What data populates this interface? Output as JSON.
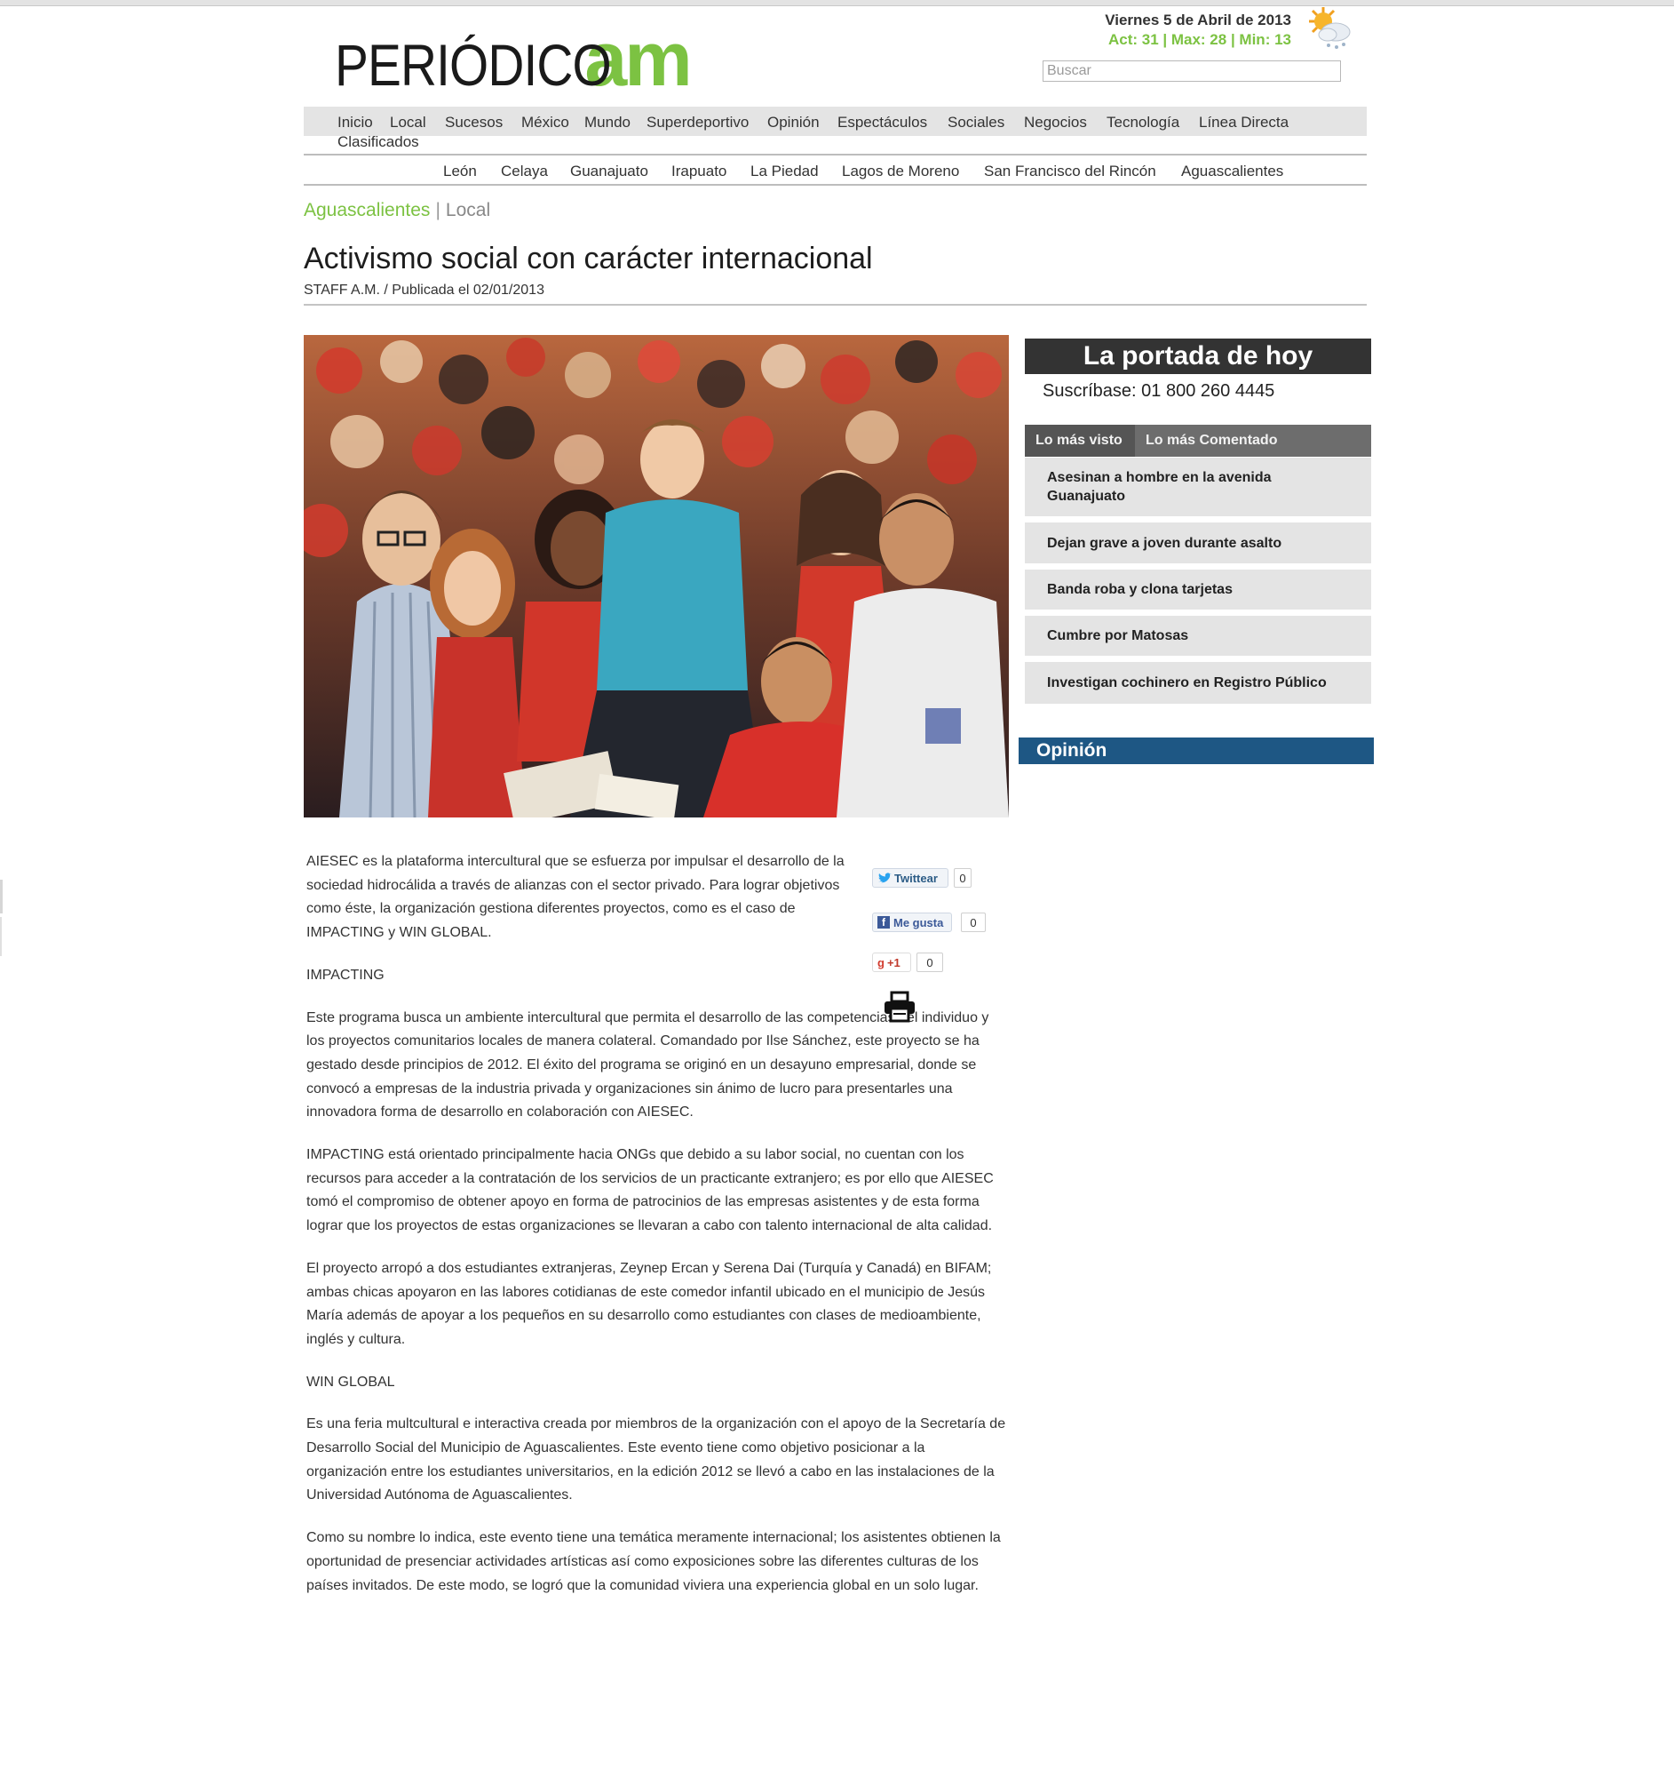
{
  "header": {
    "logo_text": "PERIÓDICO",
    "logo_accent": "am",
    "date": "Viernes 5 de Abril de 2013",
    "weather": "Act: 31 | Max: 28 | Min: 13",
    "weather_icon": "sun-cloud-icon",
    "search_placeholder": "Buscar"
  },
  "nav": {
    "items": [
      "Inicio",
      "Local",
      "Sucesos",
      "México",
      "Mundo",
      "Superdeportivo",
      "Opinión",
      "Espectáculos",
      "Sociales",
      "Negocios",
      "Tecnología",
      "Línea Directa",
      "Clasificados"
    ],
    "cities": [
      "León",
      "Celaya",
      "Guanajuato",
      "Irapuato",
      "La Piedad",
      "Lagos de Moreno",
      "San Francisco del Rincón",
      "Aguascalientes"
    ]
  },
  "breadcrumb": {
    "section": "Aguascalientes",
    "separator": "|",
    "category": "Local"
  },
  "article": {
    "title": "Activismo social con carácter internacional",
    "byline": "STAFF A.M. / Publicada el 02/01/2013",
    "paragraphs": [
      "AIESEC  es la plataforma intercultural que se esfuerza por impulsar el desarrollo de la sociedad hidrocálida a través de alianzas con el sector privado. Para lograr objetivos como éste, la organización gestiona diferentes proyectos, como es el caso de IMPACTING y WIN GLOBAL.",
      "IMPACTING",
      "Este programa busca un ambiente intercultural que permita el desarrollo de las competencias del individuo y los proyectos comunitarios locales de manera colateral. Comandado por Ilse Sánchez, este proyecto se ha gestado desde principios de 2012. El éxito del programa se originó en un desayuno empresarial, donde se convocó a empresas de la industria privada y organizaciones sin ánimo de lucro para presentarles una innovadora forma de desarrollo en colaboración con AIESEC.",
      "IMPACTING está orientado principalmente hacia ONGs que debido a su labor social, no cuentan con los recursos para acceder a la contratación de los servicios de un practicante extranjero; es por ello que AIESEC tomó el compromiso de obtener apoyo en forma de patrocinios de las empresas asistentes y de esta forma lograr que los proyectos de estas organizaciones se llevaran a cabo con talento internacional de alta calidad.",
      "El proyecto arropó a dos estudiantes extranjeras, Zeynep Ercan y Serena Dai (Turquía y Canadá) en BIFAM; ambas chicas apoyaron en las labores cotidianas de este comedor infantil ubicado en el municipio de Jesús María además de apoyar a los pequeños en su desarrollo como estudiantes con clases de medioambiente, inglés y cultura.",
      "WIN GLOBAL",
      "Es una feria multcultural e interactiva creada por miembros de la organización con el apoyo de la Secretaría de Desarrollo Social del Municipio de Aguascalientes. Este evento tiene como objetivo posicionar a la organización entre los estudiantes universitarios, en la edición 2012 se llevó a cabo en las instalaciones de la Universidad Autónoma de Aguascalientes.",
      "Como su nombre lo indica, este evento tiene una temática meramente internacional; los asistentes obtienen la oportunidad de presenciar actividades artísticas así como exposiciones sobre las diferentes culturas de los países invitados. De este modo, se logró que la comunidad viviera una experiencia global en un solo lugar."
    ]
  },
  "share": {
    "twitter_label": "Twittear",
    "twitter_count": "0",
    "facebook_label": "Me gusta",
    "facebook_count": "0",
    "gplus_label": "+1",
    "gplus_count": "0"
  },
  "sidebar": {
    "portada_title": "La portada de hoy",
    "subscribe_text": "Suscríbase: 01 800 260 4445",
    "tabs": [
      "Lo más visto",
      "Lo más Comentado"
    ],
    "most_viewed": [
      "Asesinan a hombre en la avenida Guanajuato",
      "Dejan grave a joven durante asalto",
      "Banda roba y clona tarjetas",
      "Cumbre por Matosas",
      "Investigan cochinero en Registro Público"
    ],
    "opinion_title": "Opinión"
  },
  "colors": {
    "brand_green": "#7cc242",
    "opinion_blue": "#1e5784",
    "dark_bar": "#333333"
  }
}
